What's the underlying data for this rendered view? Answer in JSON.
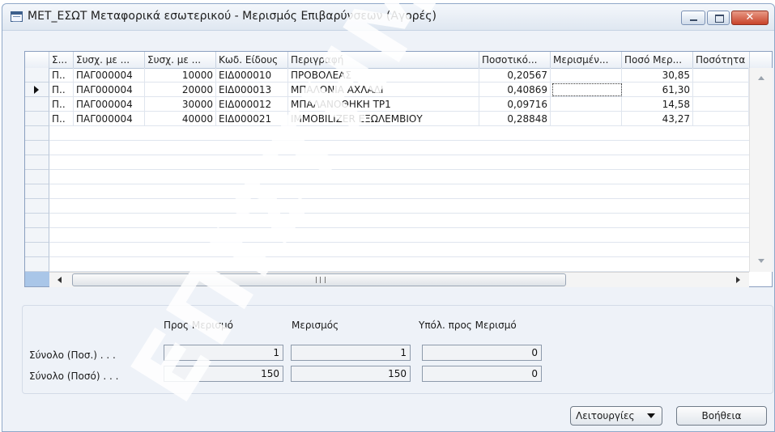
{
  "window": {
    "title": "ΜΕΤ_ΕΣΩΤ Μεταφορικά εσωτερικού - Μερισμός Επιβαρύνσεων (Αγορές)",
    "close_glyph": "✕"
  },
  "grid": {
    "columns": [
      "Σ...",
      "Συσχ. με ...",
      "Συσχ. με ...",
      "Κωδ. Είδους",
      "Περιγραφή",
      "Ποσοτικό...",
      "Μερισμέν...",
      "Ποσό Μερ...",
      "Ποσότητα"
    ],
    "rows": [
      [
        "Π..",
        "ΠΑΓ000004",
        "10000",
        "ΕΙΔ000010",
        "ΠΡΟΒΟΛΕΑΣ",
        "0,20567",
        "",
        "30,85",
        ""
      ],
      [
        "Π..",
        "ΠΑΓ000004",
        "20000",
        "ΕΙΔ000013",
        "ΜΠΑΛΟΝΙΑ ΑΧΛΑΔΙ",
        "0,40869",
        "",
        "61,30",
        ""
      ],
      [
        "Π..",
        "ΠΑΓ000004",
        "30000",
        "ΕΙΔ000012",
        "ΜΠΑΛΑΝΟΘΗΚΗ ΤΡ1",
        "0,09716",
        "",
        "14,58",
        ""
      ],
      [
        "Π..",
        "ΠΑΓ000004",
        "40000",
        "ΕΙΔ000021",
        "IMMOBILIZER ΕΞΩΛΕΜΒΙΟΥ",
        "0,28848",
        "",
        "43,27",
        ""
      ]
    ],
    "selected_row": 2,
    "hscroll_grip": "III"
  },
  "totals": {
    "headers": [
      "Προς Μερισμό",
      "Μερισμός",
      "Υπόλ. προς Μερισμό"
    ],
    "rows": [
      {
        "label": "Σύνολο (Ποσ.) . . .",
        "values": [
          "1",
          "1",
          "0"
        ]
      },
      {
        "label": "Σύνολο (Ποσό) . . .",
        "values": [
          "150",
          "150",
          "0"
        ]
      }
    ]
  },
  "buttons": {
    "functions": "Λειτουργίες",
    "help": "Βοήθεια"
  },
  "watermark": {
    "text": "ΕΠΙΣΤΗΜΗ",
    "color": "#ffffff"
  }
}
